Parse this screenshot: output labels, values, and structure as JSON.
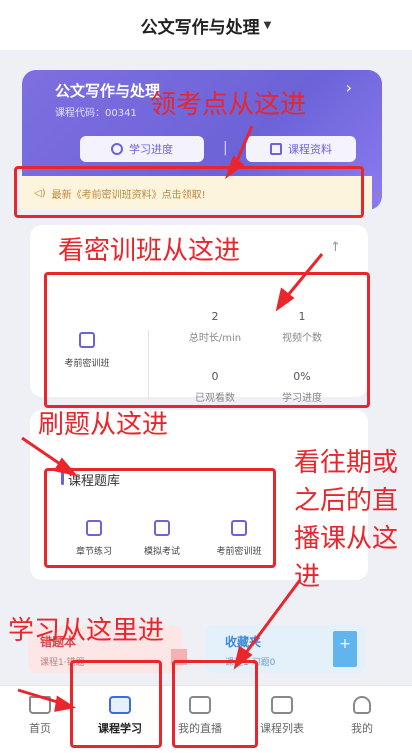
{
  "header": {
    "title": "公文写作与处理"
  },
  "course": {
    "name": "公文写作与处理",
    "code": "课程代码：00341",
    "progress_label": "学习进度",
    "materials_label": "课程资料"
  },
  "notice": {
    "text": "最新《考前密训班资料》点击领取!"
  },
  "live_panel": {
    "section_label": "考前密训班",
    "total_duration": {
      "value": "2",
      "label": "总时长/min"
    },
    "video_count": {
      "value": "1",
      "label": "视频个数"
    },
    "watched": {
      "value": "0",
      "label": "已观看数"
    },
    "progress": {
      "value": "0%",
      "label": "学习进度"
    }
  },
  "question_bank": {
    "title": "课程题库",
    "items": [
      {
        "label": "章节练习",
        "icon": "chapter-icon"
      },
      {
        "label": "模拟考试",
        "icon": "exam-icon"
      },
      {
        "label": "考前密训班",
        "icon": "training-icon"
      }
    ]
  },
  "wrong_card": {
    "title": "错题本",
    "subtitle": "课程1·错题"
  },
  "fav_card": {
    "title": "收藏夹",
    "subtitle": "课程1·习题0"
  },
  "tabbar": [
    {
      "label": "首页",
      "icon": "home-icon"
    },
    {
      "label": "课程学习",
      "icon": "play-icon"
    },
    {
      "label": "我的直播",
      "icon": "camera-icon"
    },
    {
      "label": "课程列表",
      "icon": "list-icon"
    },
    {
      "label": "我的",
      "icon": "user-icon"
    }
  ],
  "annotations": {
    "materials": "领考点从这进",
    "live": "看密训班从这进",
    "bank": "刷题从这进",
    "replay": "看往期或之后的直播课从这进",
    "study": "学习从这里进"
  },
  "colors": {
    "accent": "#6c63d8",
    "annotation": "#e8262c",
    "notice_bg": "#fdf4de"
  }
}
